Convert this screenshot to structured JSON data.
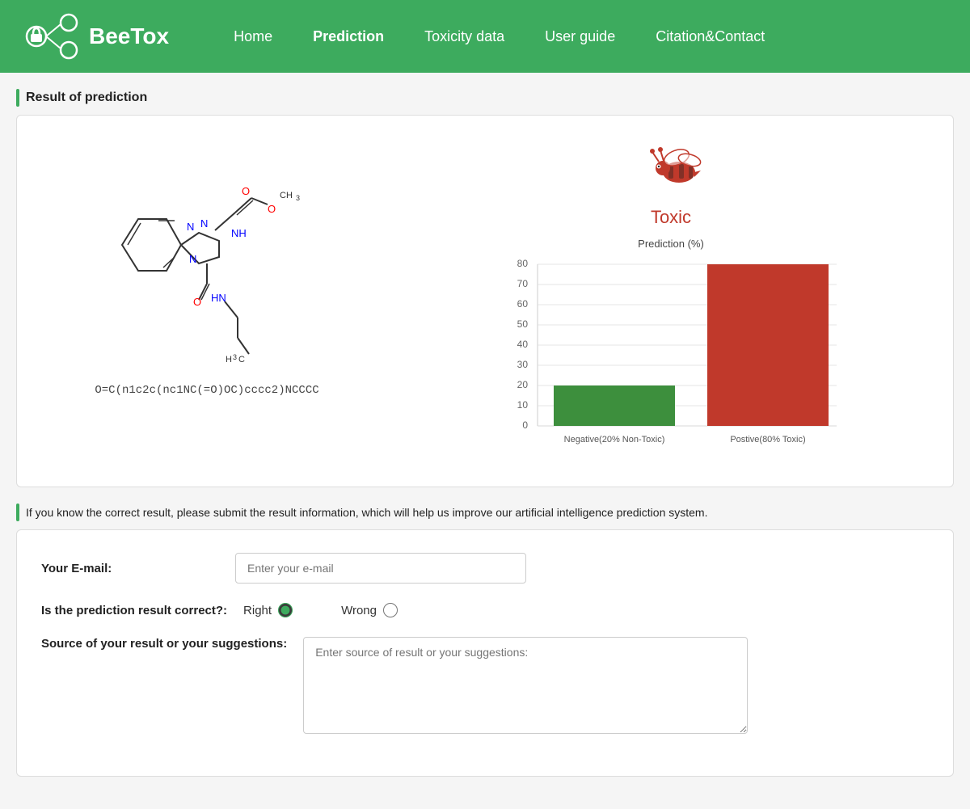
{
  "nav": {
    "logo_text": "BeeTox",
    "links": [
      {
        "label": "Home",
        "active": false
      },
      {
        "label": "Prediction",
        "active": true
      },
      {
        "label": "Toxicity data",
        "active": false
      },
      {
        "label": "User guide",
        "active": false
      },
      {
        "label": "Citation&Contact",
        "active": false
      }
    ]
  },
  "result_section": {
    "title": "Result of prediction",
    "smiles": "O=C(n1c2c(nc1NC(=O)OC)cccc2)NCCCC",
    "toxic_label": "Toxic",
    "chart_title": "Prediction (%)",
    "bars": [
      {
        "label": "Negative(20% Non-Toxic)",
        "value": 20,
        "color": "#3d8f3d"
      },
      {
        "label": "Postive(80% Toxic)",
        "value": 80,
        "color": "#c0392b"
      }
    ],
    "y_axis": [
      0,
      10,
      20,
      30,
      40,
      50,
      60,
      70,
      80
    ]
  },
  "feedback_section": {
    "notice": "If you know the correct result, please submit the result information, which will help us improve our artificial intelligence prediction system.",
    "email_label": "Your E-mail:",
    "email_placeholder": "Enter your e-mail",
    "correct_label": "Is the prediction result correct?:",
    "right_option": "Right",
    "wrong_option": "Wrong",
    "source_label": "Source of your result or your suggestions:",
    "source_placeholder": "Enter source of result or your suggestions:"
  }
}
